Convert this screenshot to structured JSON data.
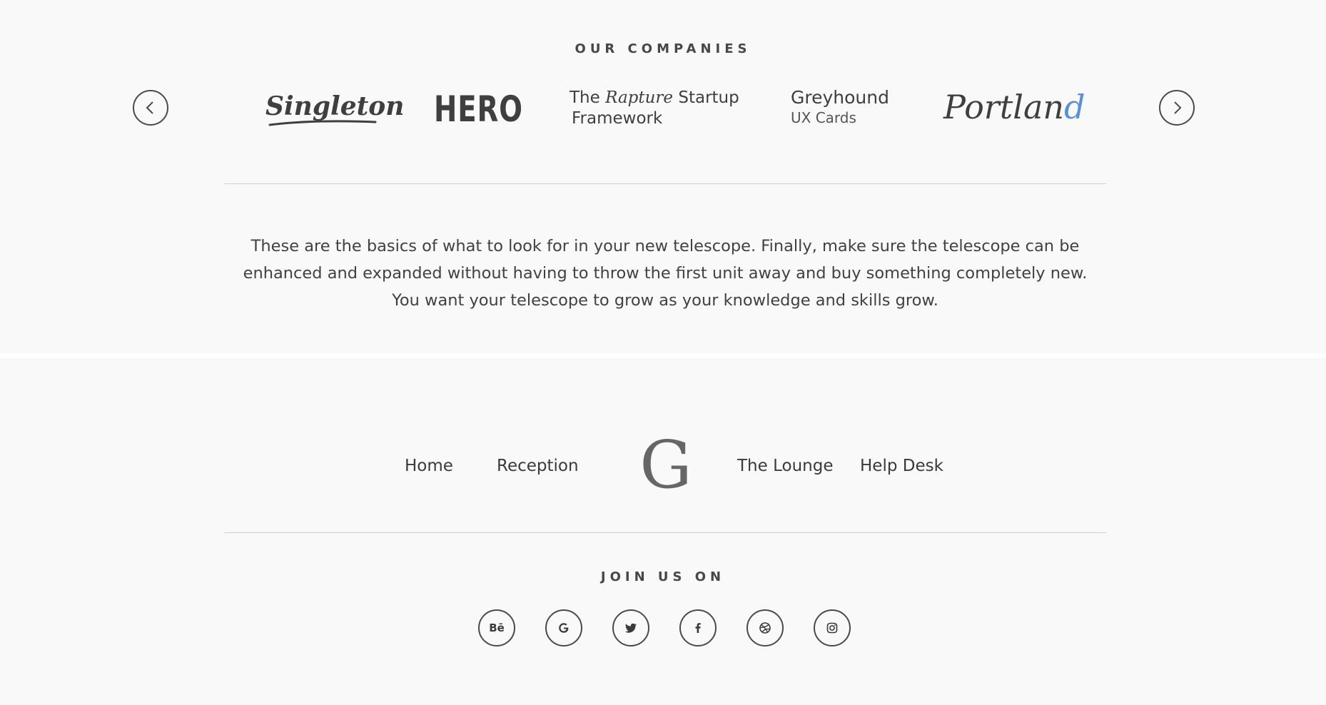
{
  "companies": {
    "heading": "OUR COMPANIES",
    "logos": {
      "singleton": "Singleton",
      "hero": "HERO",
      "rapture_line1_a": "The ",
      "rapture_line1_b": "Rapture",
      "rapture_line1_c": " Startup",
      "rapture_line2": "Framework",
      "greyhound_title": "Greyhound",
      "greyhound_sub": "UX Cards",
      "portland_main": "Portlan",
      "portland_accent": "d"
    },
    "accent_color": "#5b8fd6"
  },
  "quote": {
    "text": "These are the basics of what to look for in your new telescope. Finally, make sure the telescope can be enhanced and expanded without having to throw the first unit away and buy something completely new. You want your telescope to grow as your knowledge and skills grow."
  },
  "footer": {
    "nav": {
      "home": "Home",
      "reception": "Reception",
      "lounge": "The Lounge",
      "help": "Help Desk"
    },
    "brand_letter": "G",
    "join_heading": "JOIN US ON",
    "social": {
      "behance": "Bē",
      "icons": [
        "behance-icon",
        "google-icon",
        "twitter-icon",
        "facebook-icon",
        "dribbble-icon",
        "instagram-icon"
      ]
    }
  }
}
